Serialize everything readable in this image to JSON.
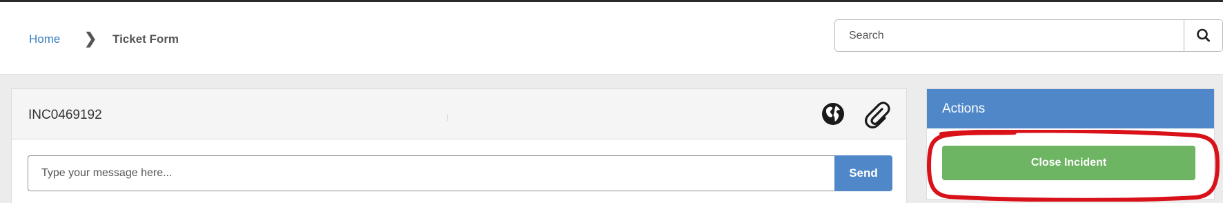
{
  "breadcrumb": {
    "home": "Home",
    "separator": "❯",
    "current": "Ticket Form"
  },
  "search": {
    "placeholder": "Search",
    "button_icon": "search-icon"
  },
  "ticket": {
    "id": "INC0469192",
    "icons": [
      "globe-icon",
      "paperclip-icon"
    ],
    "message_placeholder": "Type your message here...",
    "send_label": "Send"
  },
  "actions": {
    "title": "Actions",
    "close_label": "Close Incident",
    "highlight_color": "#d9121a"
  },
  "colors": {
    "accent_blue": "#4f87c8",
    "success_green": "#6db463",
    "link_blue": "#3a7fc1"
  }
}
